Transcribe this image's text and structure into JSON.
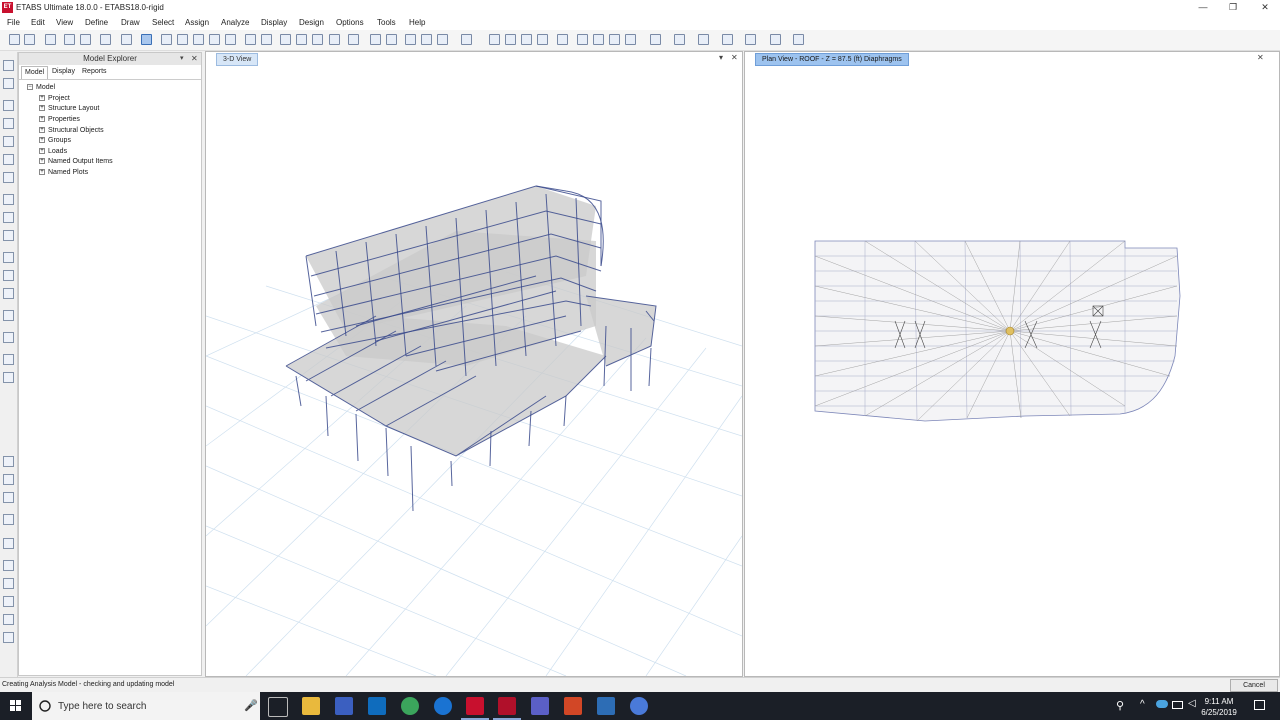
{
  "window": {
    "title": "ETABS Ultimate 18.0.0 - ETABS18.0-rigid",
    "app_icon_text": "ET",
    "minimize": "—",
    "maximize": "❐",
    "close": "✕"
  },
  "menu": [
    "File",
    "Edit",
    "View",
    "Define",
    "Draw",
    "Select",
    "Assign",
    "Analyze",
    "Display",
    "Design",
    "Options",
    "Tools",
    "Help"
  ],
  "explorer": {
    "title": "Model Explorer",
    "tabs": [
      "Model",
      "Display",
      "Reports"
    ],
    "selected_tab": "Model",
    "root": "Model",
    "items": [
      "Project",
      "Structure Layout",
      "Properties",
      "Structural Objects",
      "Groups",
      "Loads",
      "Named Output Items",
      "Named Plots"
    ]
  },
  "view3d": {
    "tab_label": "3-D View"
  },
  "plan_view": {
    "tab_label": "Plan View - ROOF - Z = 87.5 (ft)  Diaphragms"
  },
  "status": {
    "text": "Creating Analysis Model - checking and updating model",
    "cancel_label": "Cancel"
  },
  "taskbar": {
    "search_placeholder": "Type here to search",
    "time": "9:11 AM",
    "date": "6/25/2019"
  },
  "colors": {
    "frame": "#3a4a8c",
    "slab": "#c9c9c9",
    "grid": "#cfe0ef",
    "plan_lines": "#7c86b8",
    "accent": "#9dc3ef"
  }
}
